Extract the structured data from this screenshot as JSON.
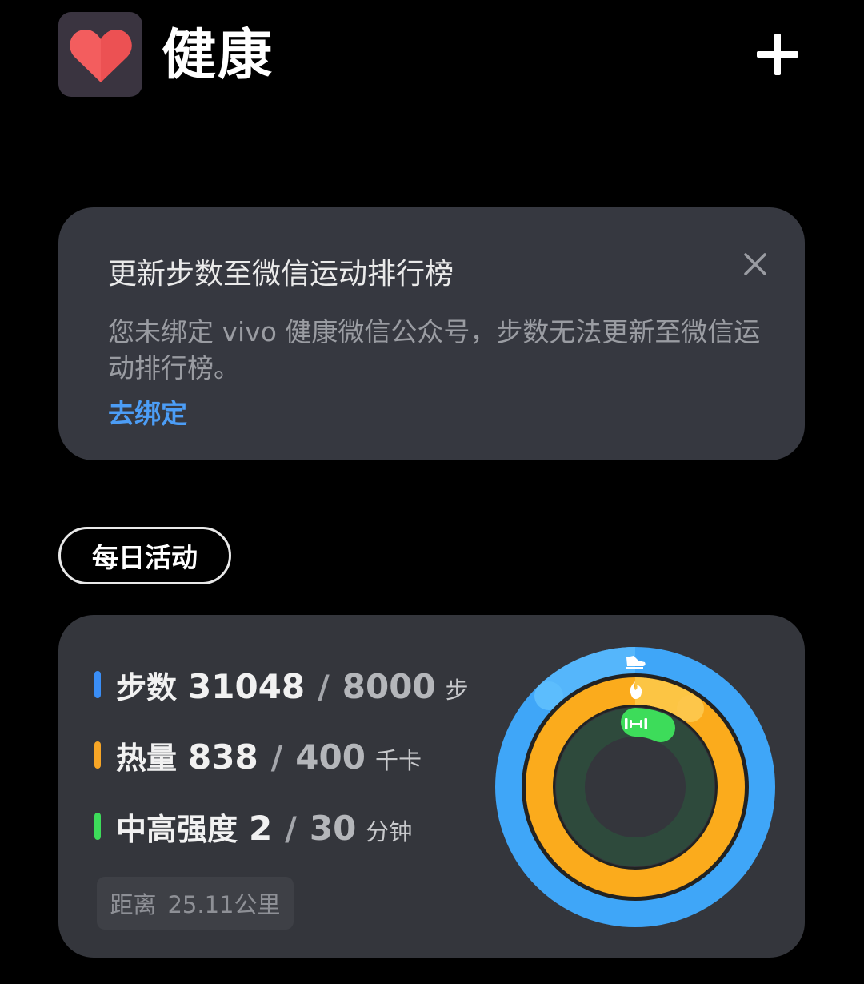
{
  "header": {
    "title": "健康",
    "icon": "heart-icon",
    "add_icon": "plus-icon"
  },
  "notice": {
    "title": "更新步数至微信运动排行榜",
    "body": "您未绑定 vivo 健康微信公众号，步数无法更新至微信运动排行榜。",
    "link": "去绑定",
    "close_icon": "close-icon"
  },
  "section": {
    "label": "每日活动"
  },
  "activity": {
    "steps": {
      "label": "步数",
      "value": "31048",
      "slash": "/",
      "goal": "8000",
      "unit": "步",
      "color": "#3a8ef6",
      "progress": 3.881
    },
    "calories": {
      "label": "热量",
      "value": "838",
      "slash": "/",
      "goal": "400",
      "unit": "千卡",
      "color": "#f7a626",
      "progress": 2.095
    },
    "intensity": {
      "label": "中高强度",
      "value": "2",
      "slash": "/",
      "goal": "30",
      "unit": "分钟",
      "color": "#3ddc5a",
      "progress": 0.067
    },
    "distance": {
      "label": "距离",
      "value": "25.11公里"
    }
  },
  "colors": {
    "background": "#000000",
    "card": "#363840",
    "link": "#4c9df6",
    "steps_ring": "#3fa6f8",
    "calories_ring": "#fbb124",
    "intensity_ring": "#2e4a3c",
    "intensity_progress": "#3ddc5a"
  }
}
